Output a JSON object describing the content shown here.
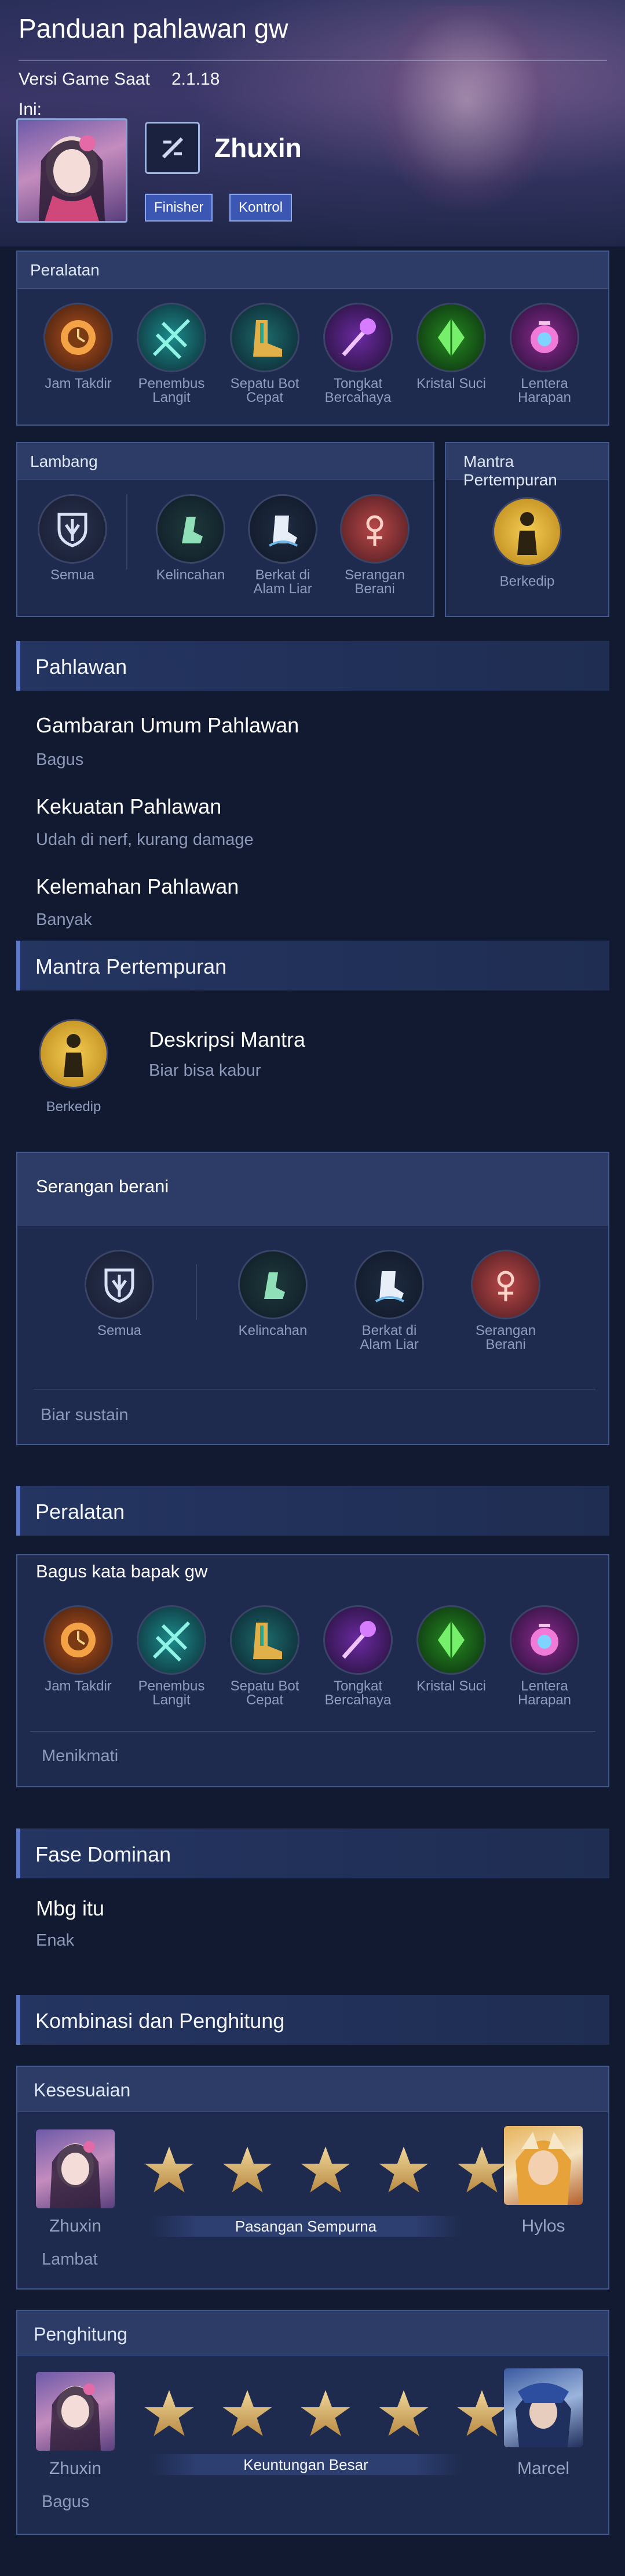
{
  "header": {
    "title": "Panduan pahlawan gw",
    "version_label": "Versi Game Saat",
    "version_value": "2.1.18",
    "ini_label": "Ini:",
    "hero_name": "Zhuxin",
    "tags": [
      "Finisher",
      "Kontrol"
    ]
  },
  "equipment": {
    "title": "Peralatan",
    "items": [
      {
        "label": "Jam Takdir",
        "icon": "clock-of-destiny-icon",
        "color": "#c9762b"
      },
      {
        "label": "Penembus Langit",
        "icon": "skypiercer-icon",
        "color": "#1fb4a8"
      },
      {
        "label": "Sepatu Bot Cepat",
        "icon": "boots-icon",
        "color": "#2bb6a0"
      },
      {
        "label": "Tongkat Bercahaya",
        "icon": "glowing-wand-icon",
        "color": "#8a42c8"
      },
      {
        "label": "Kristal Suci",
        "icon": "holy-crystal-icon",
        "color": "#3cc43a"
      },
      {
        "label": "Lentera Harapan",
        "icon": "lantern-icon",
        "color": "#c84ab8"
      }
    ]
  },
  "emblem": {
    "title": "Lambang",
    "main": {
      "label": "Semua",
      "icon": "basic-emblem-icon"
    },
    "talents": [
      {
        "label": "Kelincahan",
        "icon": "agility-icon"
      },
      {
        "label": "Berkat di Alam Liar",
        "icon": "wilderness-blessing-icon"
      },
      {
        "label": "Serangan Berani",
        "icon": "brave-smite-icon"
      }
    ]
  },
  "spell": {
    "title": "Mantra Pertempuran",
    "label": "Berkedip",
    "icon": "flicker-icon"
  },
  "hero_section": {
    "title": "Pahlawan",
    "overview_title": "Gambaran Umum Pahlawan",
    "overview_text": "Bagus",
    "strength_title": "Kekuatan Pahlawan",
    "strength_text": "Udah di nerf, kurang damage",
    "weakness_title": "Kelemahan Pahlawan",
    "weakness_text": "Banyak"
  },
  "spell_section": {
    "title": "Mantra Pertempuran",
    "spell_label": "Berkedip",
    "desc_title": "Deskripsi Mantra",
    "desc_text": "Biar bisa kabur"
  },
  "emblem_section": {
    "title": "Serangan berani",
    "main_label": "Semua",
    "talent_labels": [
      "Kelincahan",
      "Berkat di Alam Liar",
      "Serangan Berani"
    ],
    "note": "Biar sustain"
  },
  "equipment_section": {
    "title": "Peralatan",
    "build_title": "Bagus kata bapak gw",
    "labels": [
      "Jam Takdir",
      "Penembus Langit",
      "Sepatu Bot Cepat",
      "Tongkat Bercahaya",
      "Kristal Suci",
      "Lentera Harapan"
    ],
    "note": "Menikmati"
  },
  "dominant": {
    "title": "Fase Dominan",
    "heading": "Mbg itu",
    "text": "Enak"
  },
  "combo": {
    "title": "Kombinasi dan Penghitung",
    "compat": {
      "title": "Kesesuaian",
      "left": "Zhuxin",
      "right": "Hylos",
      "rating": 5,
      "badge": "Pasangan Sempurna",
      "note": "Lambat"
    },
    "counter": {
      "title": "Penghitung",
      "left": "Zhuxin",
      "right": "Marcel",
      "rating": 5,
      "badge": "Keuntungan Besar",
      "note": "Bagus"
    }
  }
}
